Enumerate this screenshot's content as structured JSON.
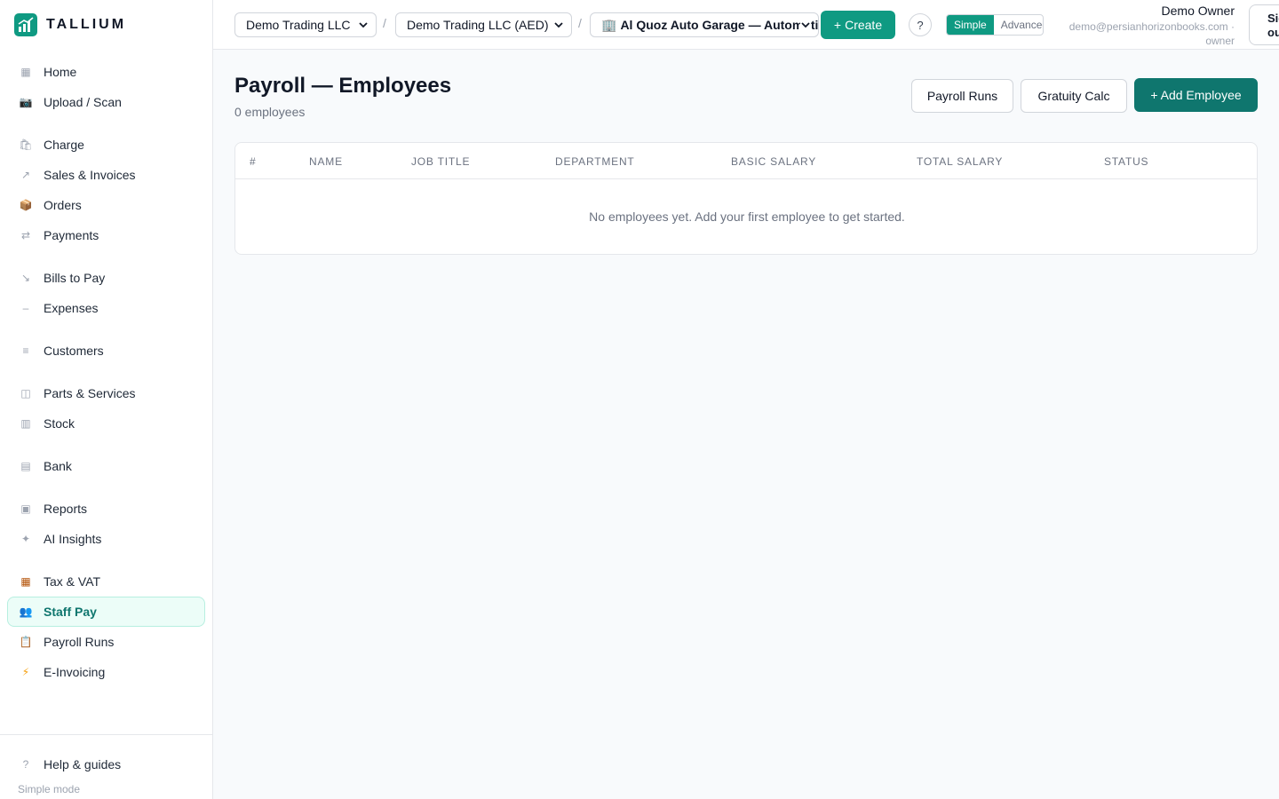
{
  "app": {
    "name": "TALLIUM"
  },
  "sidebar": {
    "items": [
      {
        "label": "Home",
        "icon": "grid-icon"
      },
      {
        "label": "Upload / Scan",
        "icon": "camera-icon"
      },
      {
        "label": "Charge",
        "icon": "shopping-bag-icon"
      },
      {
        "label": "Sales & Invoices",
        "icon": "arrow-up-right-icon"
      },
      {
        "label": "Orders",
        "icon": "package-icon"
      },
      {
        "label": "Payments",
        "icon": "arrows-swap-icon"
      },
      {
        "label": "Bills to Pay",
        "icon": "arrow-down-right-icon"
      },
      {
        "label": "Expenses",
        "icon": "minus-icon"
      },
      {
        "label": "Customers",
        "icon": "list-icon"
      },
      {
        "label": "Parts & Services",
        "icon": "box-icon"
      },
      {
        "label": "Stock",
        "icon": "columns-icon"
      },
      {
        "label": "Bank",
        "icon": "bank-icon"
      },
      {
        "label": "Reports",
        "icon": "square-icon"
      },
      {
        "label": "AI Insights",
        "icon": "sparkle-icon"
      },
      {
        "label": "Tax & VAT",
        "icon": "abacus-icon"
      },
      {
        "label": "Staff Pay",
        "icon": "people-icon"
      },
      {
        "label": "Payroll Runs",
        "icon": "clipboard-icon"
      },
      {
        "label": "E-Invoicing",
        "icon": "lightning-icon"
      }
    ],
    "active": "Staff Pay",
    "help_label": "Help & guides",
    "mode_label": "Simple mode"
  },
  "topbar": {
    "company": "Demo Trading LLC",
    "ledger": "Demo Trading LLC (AED)",
    "branch": "Al Quoz Auto Garage — Automotive",
    "create_label": "Create",
    "help_label": "?",
    "mode_simple": "Simple",
    "mode_advanced": "Advanced",
    "user_name": "Demo Owner",
    "user_email": "demo@persianhorizonbooks.com ·",
    "user_role": "owner",
    "signout_line1": "Sign",
    "signout_line2": "out"
  },
  "page": {
    "title": "Payroll — Employees",
    "count": "0 employees",
    "btn_runs": "Payroll Runs",
    "btn_gratuity": "Gratuity Calc",
    "btn_add": "+ Add Employee"
  },
  "table": {
    "headers": [
      "#",
      "NAME",
      "JOB TITLE",
      "DEPARTMENT",
      "BASIC SALARY",
      "TOTAL SALARY",
      "STATUS"
    ],
    "empty_text": "No employees yet. Add your first employee to get started."
  },
  "colors": {
    "accent": "#0f9a82",
    "primary_button": "#0f766e",
    "active_bg": "#ecfdf8"
  }
}
